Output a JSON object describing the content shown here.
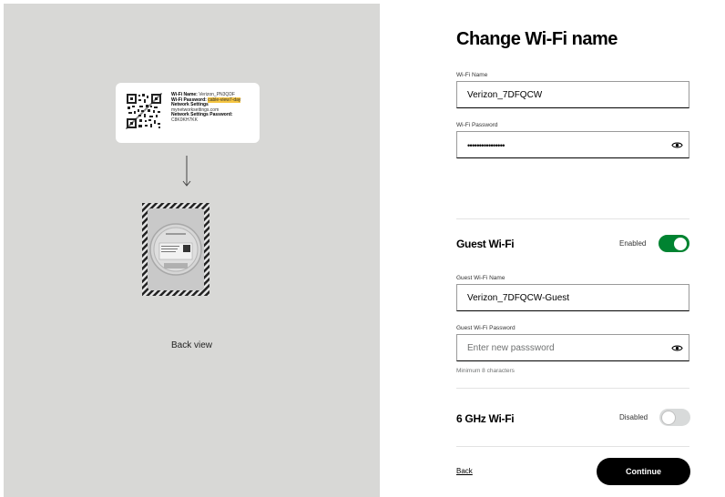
{
  "left_panel": {
    "label_card": {
      "wifi_name_label": "Wi-Fi Name:",
      "wifi_name_value": "Verizon_PN3QDF",
      "wifi_password_label": "Wi-Fi Password:",
      "wifi_password_value": "cable-view7-day",
      "network_settings_label": "Network Settings",
      "network_settings_url": "mynetworksettings.com",
      "network_settings_password_label": "Network Settings Password:",
      "network_settings_password_value": "C8K0KH7KK"
    },
    "caption": "Back view"
  },
  "form": {
    "title": "Change Wi-Fi name",
    "wifi_name": {
      "label": "Wi-Fi Name",
      "value": "Verizon_7DFQCW"
    },
    "wifi_password": {
      "label": "Wi-Fi Password",
      "masked_value": "••••••••••••••••"
    },
    "guest": {
      "title": "Guest Wi-Fi",
      "status": "Enabled",
      "toggle_on": true,
      "name": {
        "label": "Guest Wi-Fi Name",
        "value": "Verizon_7DFQCW-Guest"
      },
      "password": {
        "label": "Guest Wi-Fi Password",
        "placeholder": "Enter new passsword",
        "hint": "Minimum 8 characters"
      }
    },
    "ghz6": {
      "title": "6 GHz Wi-Fi",
      "status": "Disabled",
      "toggle_on": false
    },
    "back_label": "Back",
    "continue_label": "Continue"
  },
  "colors": {
    "left_bg": "#d8d8d6",
    "toggle_on": "#008331",
    "toggle_off": "#d8dada",
    "button_bg": "#000000"
  },
  "icons": {
    "eye": "eye-icon",
    "arrow": "arrow-down-icon",
    "qr": "qr-code-icon"
  }
}
